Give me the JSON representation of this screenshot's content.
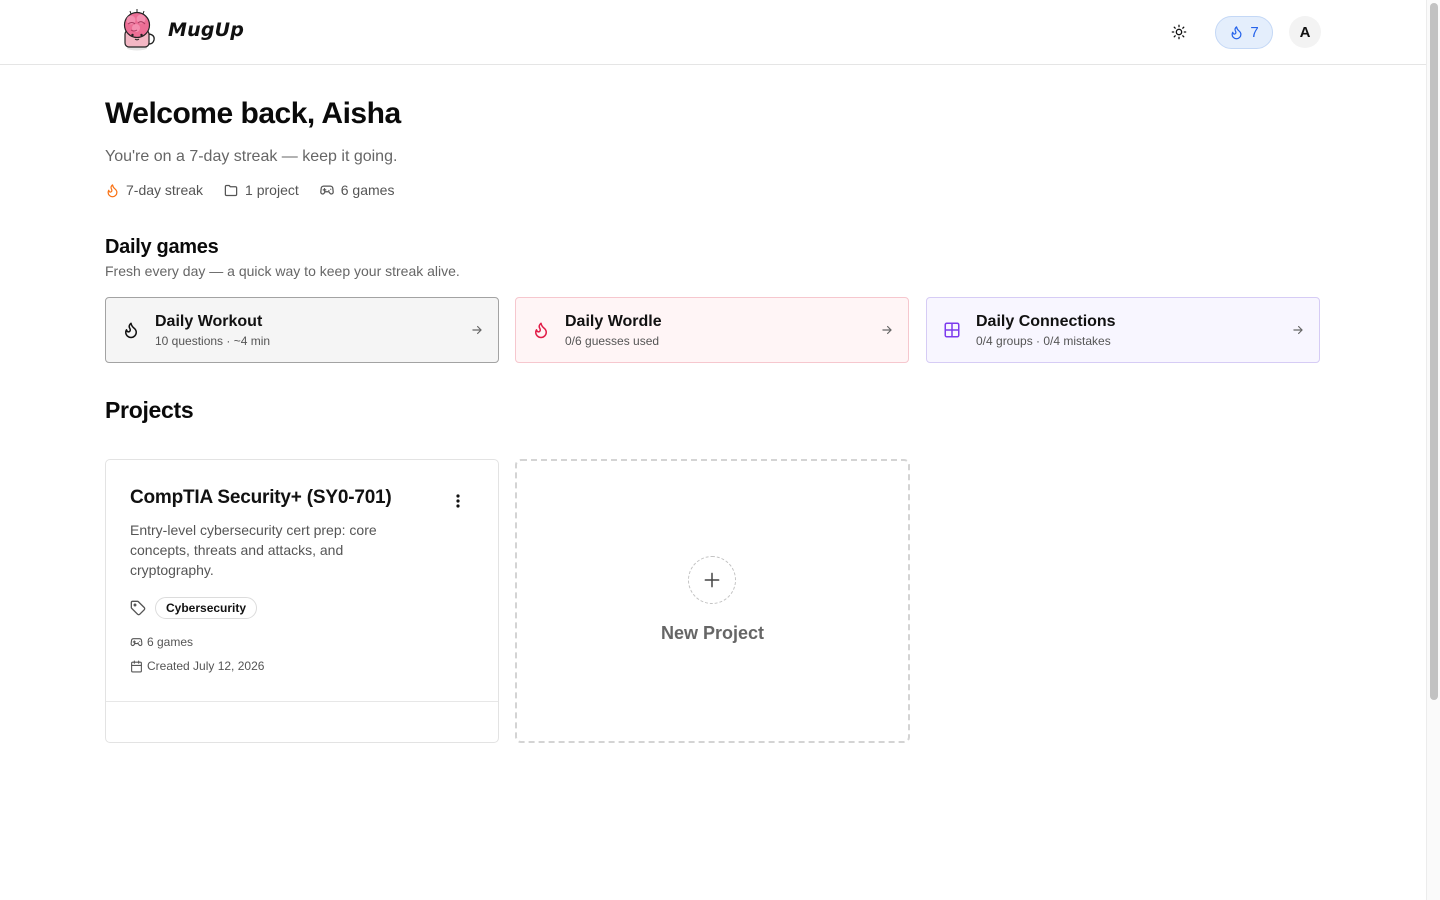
{
  "header": {
    "app_name": "MugUp",
    "streak_count": "7",
    "avatar_initial": "A"
  },
  "welcome": {
    "title": "Welcome back, Aisha",
    "subtitle": "You're on a 7-day streak — keep it going.",
    "stats": {
      "streak": "7-day streak",
      "projects": "1 project",
      "games": "6 games"
    }
  },
  "daily_games": {
    "title": "Daily games",
    "subtitle": "Fresh every day — a quick way to keep your streak alive.",
    "items": [
      {
        "name": "Daily Workout",
        "meta": "10 questions · ~4 min",
        "icon": "flame-icon"
      },
      {
        "name": "Daily Wordle",
        "meta": "0/6 guesses used",
        "icon": "flame-icon"
      },
      {
        "name": "Daily Connections",
        "meta": "0/4 groups · 0/4 mistakes",
        "icon": "grid-icon"
      }
    ]
  },
  "projects": {
    "title": "Projects",
    "items": [
      {
        "title": "CompTIA Security+ (SY0-701)",
        "description": "Entry-level cybersecurity cert prep: core concepts, threats and attacks, and cryptography.",
        "tag": "Cybersecurity",
        "games": "6 games",
        "created": "Created July 12, 2026"
      }
    ],
    "new_label": "New Project"
  },
  "colors": {
    "streak_blue": "#2563eb",
    "flame_orange": "#f97316",
    "wordle_red": "#e11d48",
    "connections_purple": "#7c3aed"
  }
}
